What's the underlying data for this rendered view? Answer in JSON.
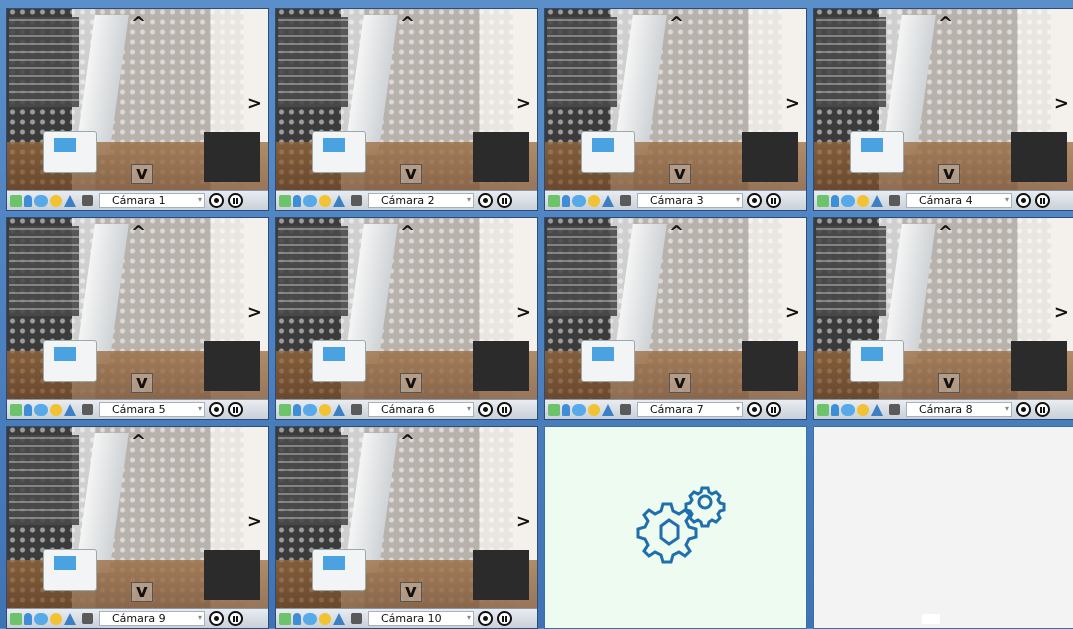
{
  "cameras": [
    {
      "label": "Cámara 1"
    },
    {
      "label": "Cámara 2"
    },
    {
      "label": "Cámara 3"
    },
    {
      "label": "Cámara 4"
    },
    {
      "label": "Cámara 5"
    },
    {
      "label": "Cámara 6"
    },
    {
      "label": "Cámara 7"
    },
    {
      "label": "Cámara 8"
    },
    {
      "label": "Cámara 9"
    },
    {
      "label": "Cámara 10"
    }
  ],
  "config_tile": {
    "icon": "settings-gears-icon"
  },
  "colors": {
    "accent": "#1f6fae",
    "toolbar_bg": "#d8dee5",
    "config_bg": "#eefbf0"
  }
}
